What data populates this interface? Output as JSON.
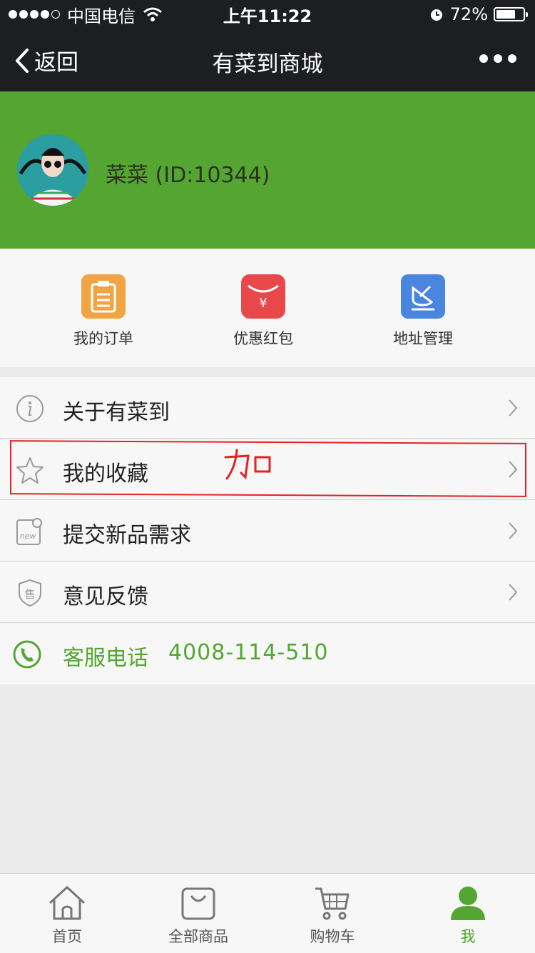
{
  "status_bar": {
    "carrier": "中国电信",
    "time": "上午11:22",
    "battery": "72%",
    "battery_level": 0.72
  },
  "nav": {
    "back_label": "返回",
    "title": "有菜到商城"
  },
  "profile": {
    "username": "菜菜 (ID:10344)"
  },
  "quick_actions": [
    {
      "label": "我的订单",
      "icon": "orders-icon",
      "color": "#f0a444"
    },
    {
      "label": "优惠红包",
      "icon": "red-packet-icon",
      "color": "#e9484b"
    },
    {
      "label": "地址管理",
      "icon": "address-icon",
      "color": "#4a86e0"
    }
  ],
  "menu": [
    {
      "label": "关于有菜到",
      "icon": "info-icon"
    },
    {
      "label": "我的收藏",
      "icon": "star-icon"
    },
    {
      "label": "提交新品需求",
      "icon": "new-tag-icon"
    },
    {
      "label": "意见反馈",
      "icon": "feedback-shield-icon"
    }
  ],
  "service": {
    "label": "客服电话",
    "number": "4008-114-510"
  },
  "annotation": {
    "handwritten": "加"
  },
  "tabs": [
    {
      "label": "首页",
      "icon": "home-icon"
    },
    {
      "label": "全部商品",
      "icon": "bag-icon"
    },
    {
      "label": "购物车",
      "icon": "cart-icon"
    },
    {
      "label": "我",
      "icon": "user-icon"
    }
  ],
  "colors": {
    "accent": "#55a532",
    "nav_bg": "#1d1e22",
    "annotation": "#e52222"
  }
}
